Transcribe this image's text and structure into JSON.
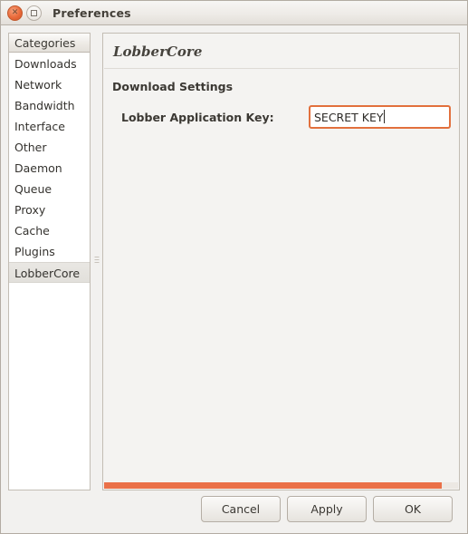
{
  "window": {
    "title": "Preferences",
    "close_icon": "close-icon",
    "maximize_icon": "maximize-icon"
  },
  "sidebar": {
    "header": "Categories",
    "items": [
      {
        "label": "Downloads",
        "selected": false
      },
      {
        "label": "Network",
        "selected": false
      },
      {
        "label": "Bandwidth",
        "selected": false
      },
      {
        "label": "Interface",
        "selected": false
      },
      {
        "label": "Other",
        "selected": false
      },
      {
        "label": "Daemon",
        "selected": false
      },
      {
        "label": "Queue",
        "selected": false
      },
      {
        "label": "Proxy",
        "selected": false
      },
      {
        "label": "Cache",
        "selected": false
      },
      {
        "label": "Plugins",
        "selected": false
      },
      {
        "label": "LobberCore",
        "selected": true
      }
    ]
  },
  "content": {
    "title": "LobberCore",
    "section_title": "Download Settings",
    "field": {
      "label": "Lobber Application Key:",
      "value": "SECRET KEY",
      "placeholder": ""
    },
    "progress": {
      "value": "95.5%",
      "color": "#ea7048"
    }
  },
  "actions": {
    "cancel": "Cancel",
    "apply": "Apply",
    "ok": "OK"
  },
  "colors": {
    "accent": "#ea7048",
    "focus_border": "#e2703d",
    "window_bg": "#f2f1ef",
    "content_bg": "#f4f3f1"
  }
}
